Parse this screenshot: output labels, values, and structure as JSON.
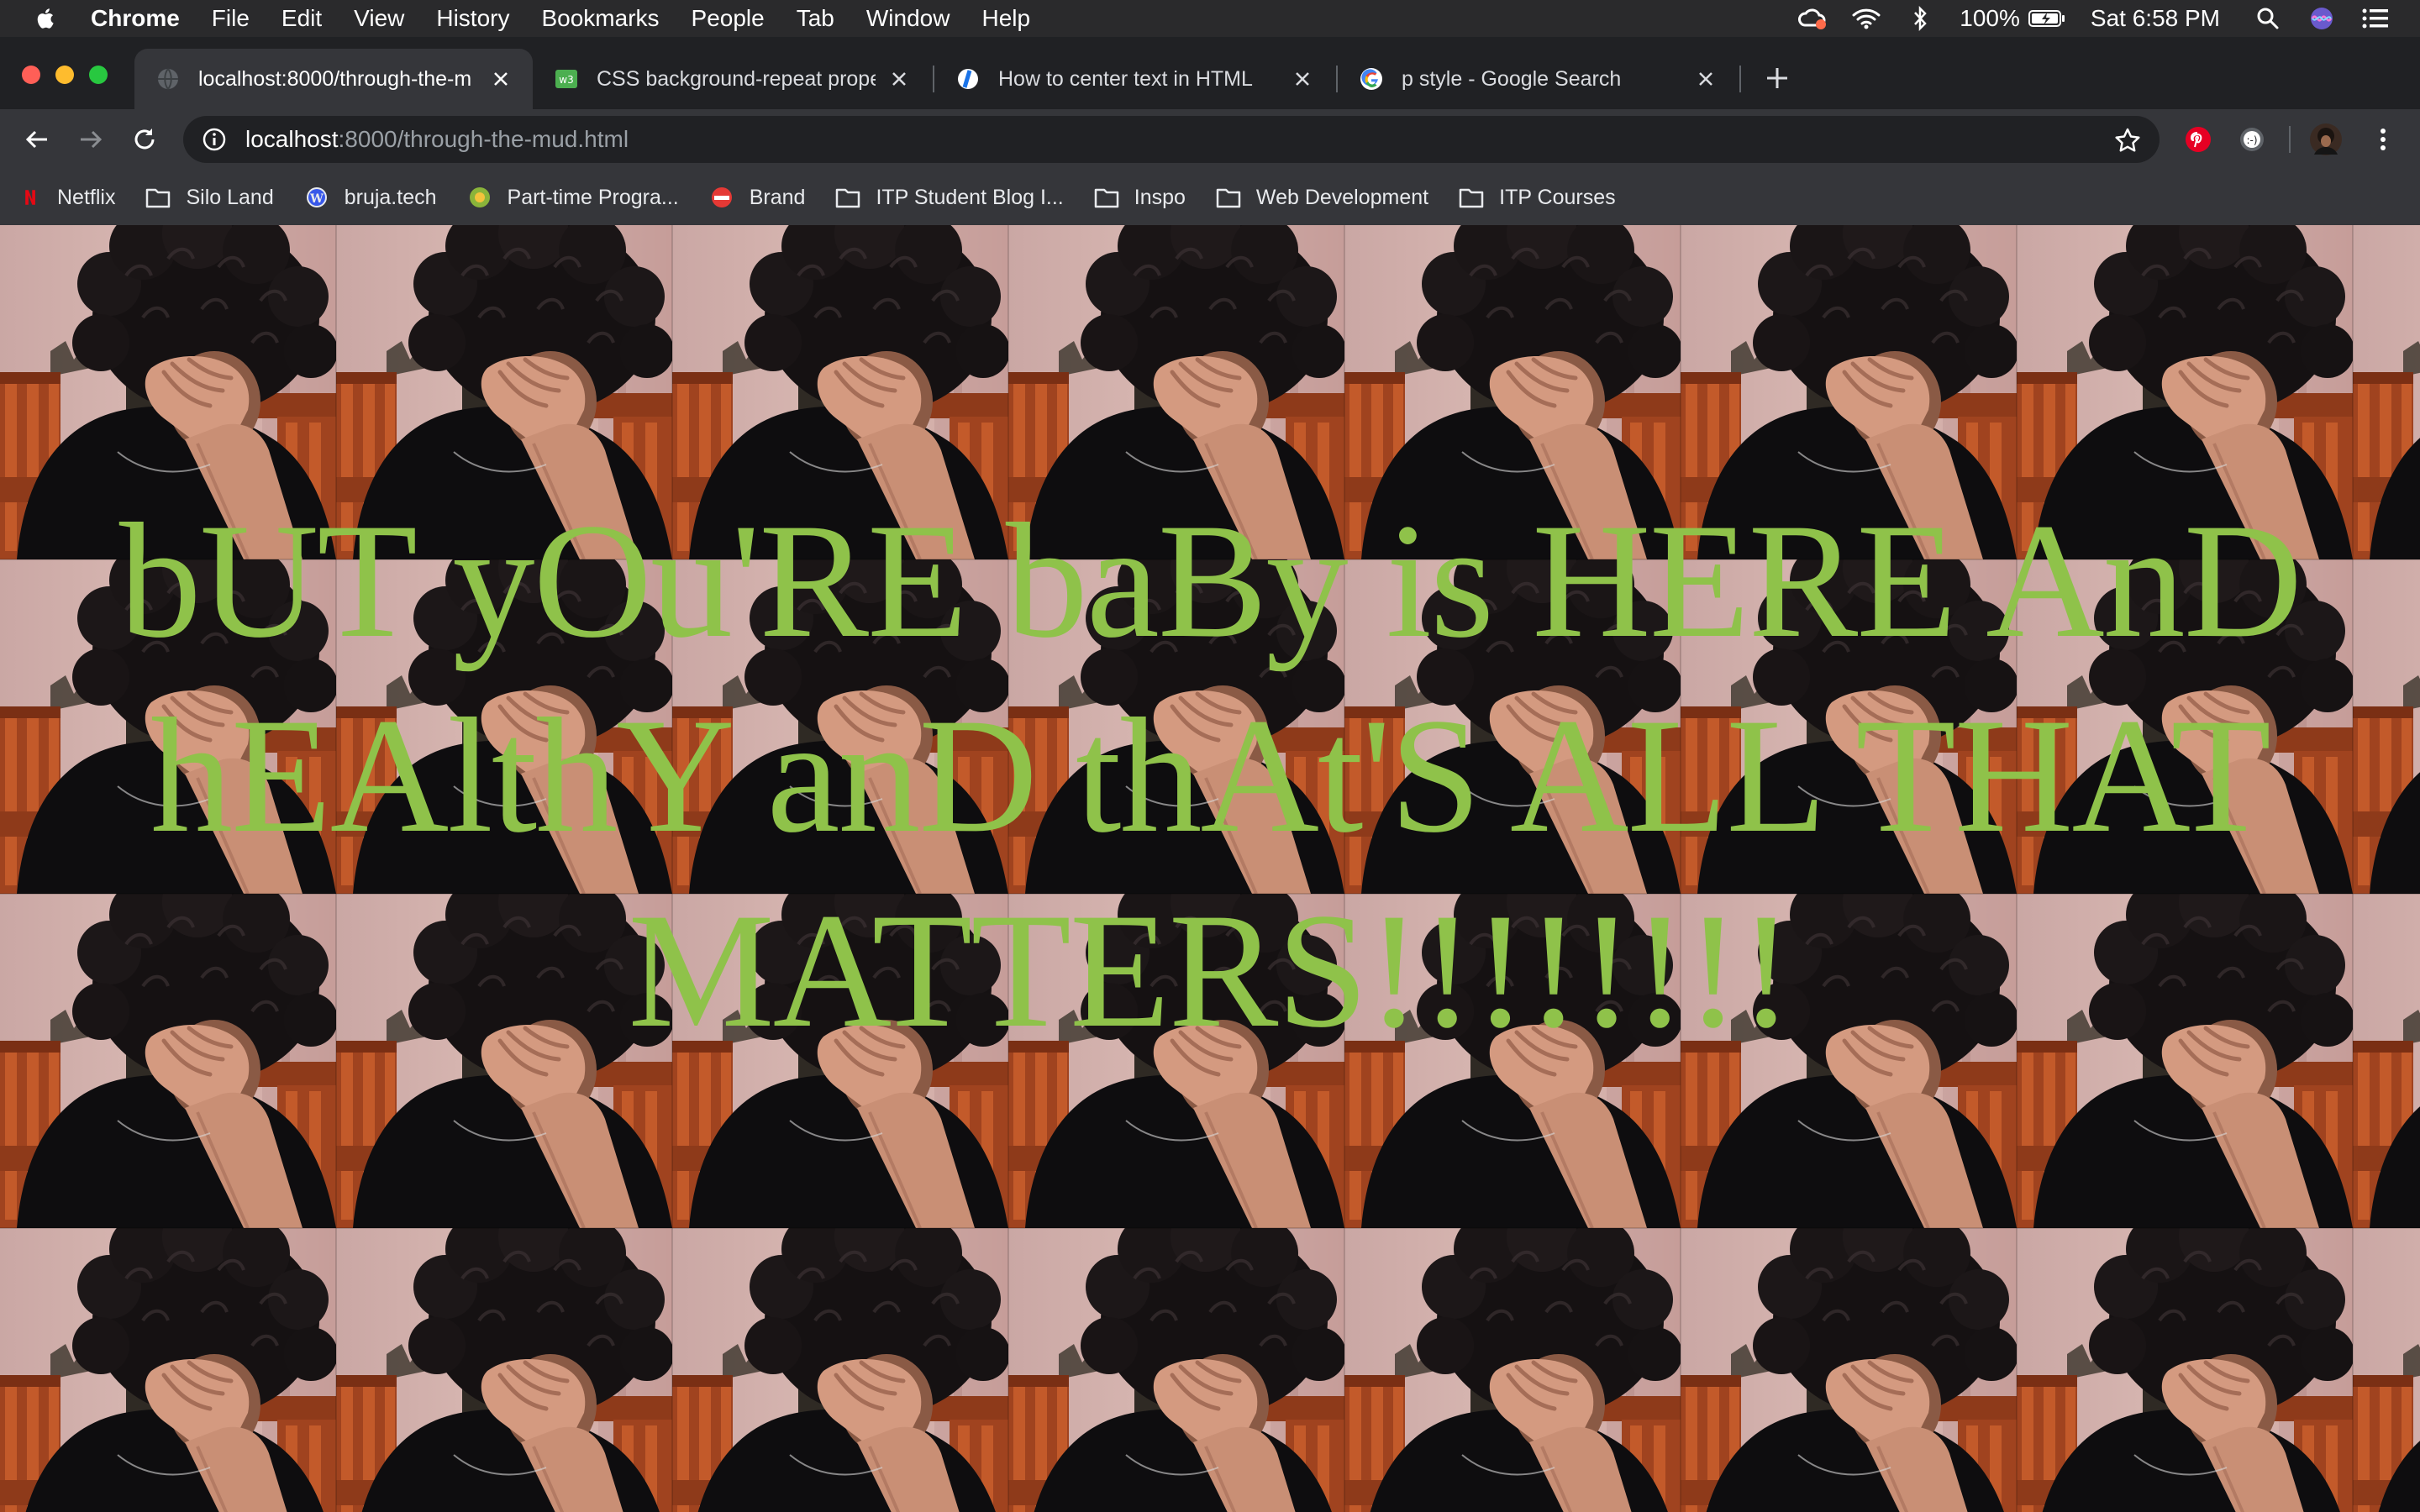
{
  "menubar": {
    "app_name": "Chrome",
    "items": [
      "File",
      "Edit",
      "View",
      "History",
      "Bookmarks",
      "People",
      "Tab",
      "Window",
      "Help"
    ],
    "battery": "100%",
    "clock": "Sat 6:58 PM"
  },
  "tabs": [
    {
      "title": "localhost:8000/through-the-m",
      "favicon": "globe-icon",
      "active": true
    },
    {
      "title": "CSS background-repeat prope",
      "favicon": "w3schools-icon",
      "active": false
    },
    {
      "title": "How to center text in HTML",
      "favicon": "codegrepper-icon",
      "active": false
    },
    {
      "title": "p style - Google Search",
      "favicon": "google-icon",
      "active": false
    }
  ],
  "omnibox": {
    "host": "localhost",
    "path": ":8000/through-the-mud.html"
  },
  "bookmarks": [
    {
      "label": "Netflix",
      "icon": "netflix-icon"
    },
    {
      "label": "Silo Land",
      "icon": "folder-icon"
    },
    {
      "label": "bruja.tech",
      "icon": "wordpress-icon"
    },
    {
      "label": "Part-time Progra...",
      "icon": "site-icon"
    },
    {
      "label": "Brand",
      "icon": "brand-icon"
    },
    {
      "label": "ITP Student Blog I...",
      "icon": "folder-icon"
    },
    {
      "label": "Inspo",
      "icon": "folder-icon"
    },
    {
      "label": "Web Development",
      "icon": "folder-icon"
    },
    {
      "label": "ITP Courses",
      "icon": "folder-icon"
    }
  ],
  "page": {
    "headline": "bUT yOu'RE baBy is HERE AnD hEAlthY anD thAt'S ALL THAT MATTERS!!!!!!!!",
    "headline_color": "#8fc24a",
    "background": "repeating photo tile"
  }
}
